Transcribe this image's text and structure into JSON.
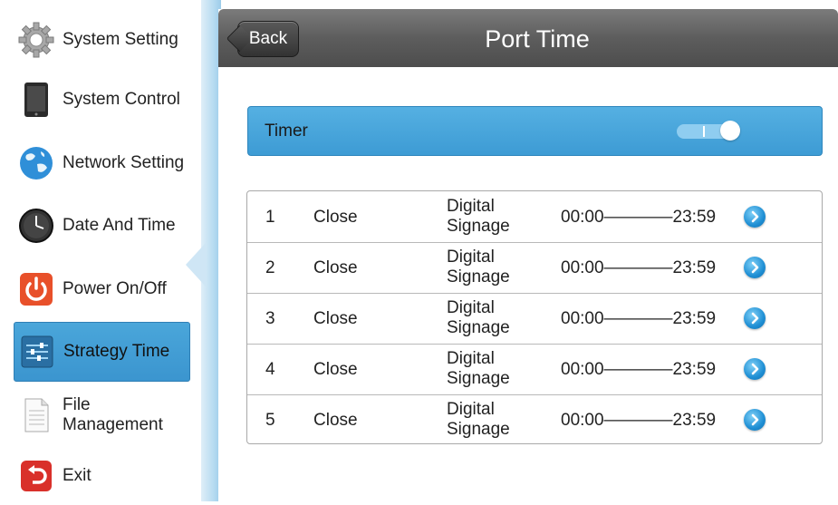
{
  "sidebar": {
    "items": [
      {
        "label": "System Setting",
        "icon": "gear-icon"
      },
      {
        "label": "System Control",
        "icon": "tablet-icon"
      },
      {
        "label": "Network Setting",
        "icon": "globe-icon"
      },
      {
        "label": "Date And Time",
        "icon": "clock-icon"
      },
      {
        "label": "Power On/Off",
        "icon": "power-icon"
      },
      {
        "label": "Strategy Time",
        "icon": "sliders-icon",
        "active": true
      },
      {
        "label": "File Management",
        "icon": "document-icon"
      },
      {
        "label": "Exit",
        "icon": "exit-icon"
      }
    ]
  },
  "header": {
    "back_label": "Back",
    "title": "Port Time"
  },
  "timer": {
    "label": "Timer",
    "toggle_on": true
  },
  "schedule": {
    "rows": [
      {
        "num": "1",
        "state": "Close",
        "mode_line1": "Digital",
        "mode_line2": "Signage",
        "time": "00:00————23:59"
      },
      {
        "num": "2",
        "state": "Close",
        "mode_line1": "Digital",
        "mode_line2": "Signage",
        "time": "00:00————23:59"
      },
      {
        "num": "3",
        "state": "Close",
        "mode_line1": "Digital",
        "mode_line2": "Signage",
        "time": "00:00————23:59"
      },
      {
        "num": "4",
        "state": "Close",
        "mode_line1": "Digital",
        "mode_line2": "Signage",
        "time": "00:00————23:59"
      },
      {
        "num": "5",
        "state": "Close",
        "mode_line1": "Digital",
        "mode_line2": "Signage",
        "time": "00:00————23:59"
      }
    ]
  },
  "colors": {
    "accent": "#3d9bd4",
    "header": "#5d5d5d",
    "power": "#e8502a",
    "exit": "#d9302a"
  }
}
